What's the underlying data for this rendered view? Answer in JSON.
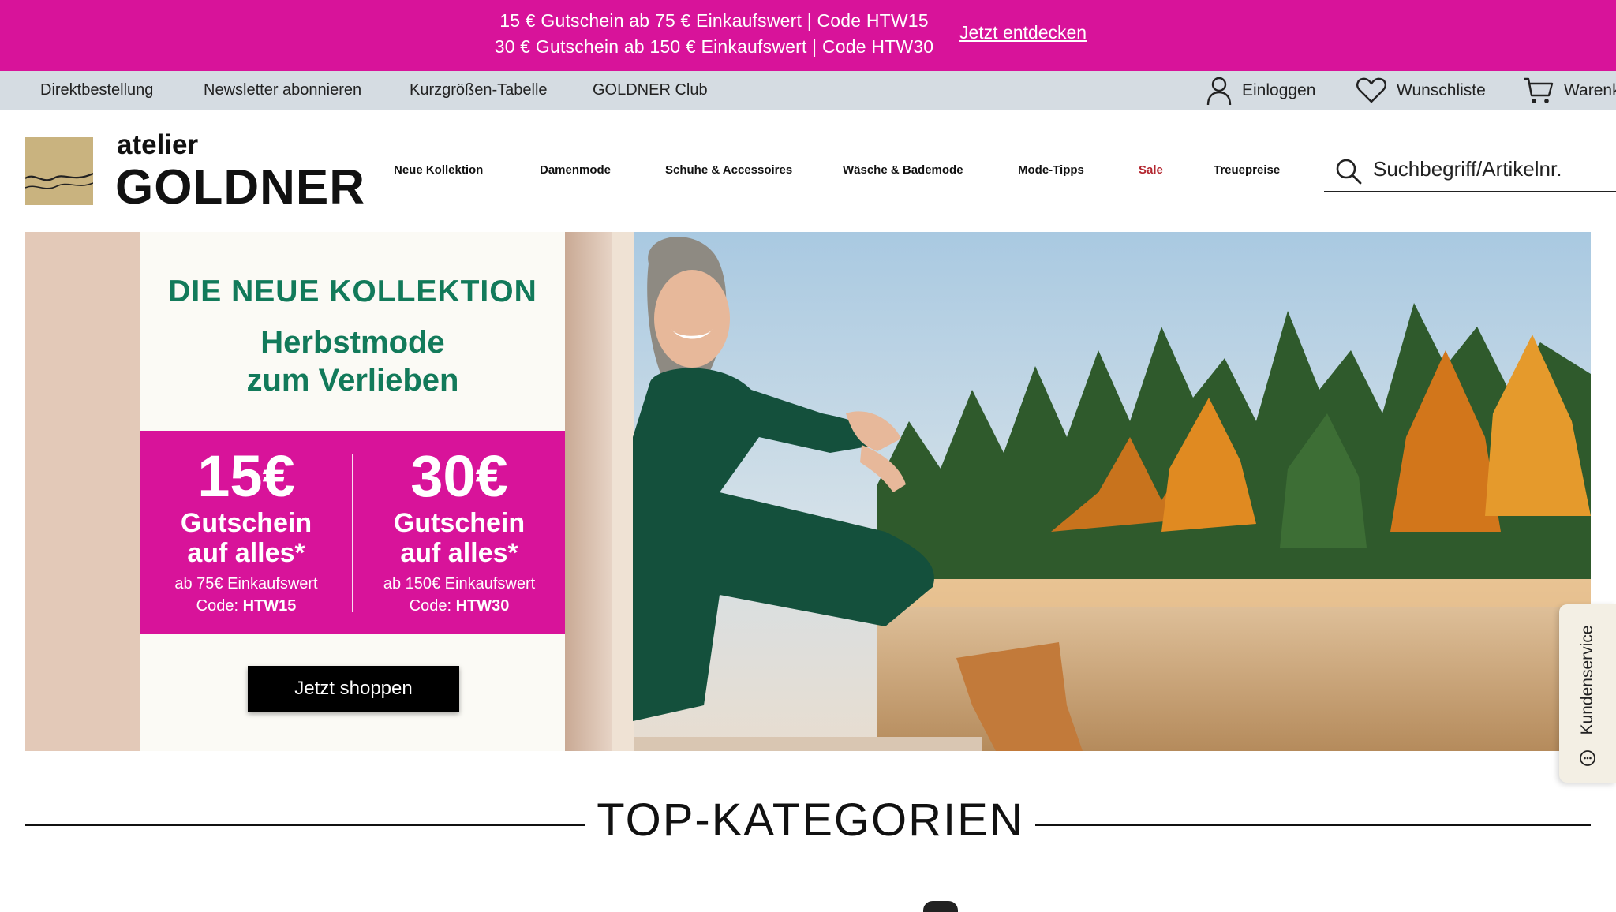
{
  "promo": {
    "line1": "15 € Gutschein ab 75 € Einkaufswert | Code HTW15",
    "line2": "30 € Gutschein ab 150 € Einkaufswert | Code HTW30",
    "link": "Jetzt entdecken",
    "color": "#d8139a"
  },
  "servicebar": {
    "links": [
      "Direktbestellung",
      "Newsletter abonnieren",
      "Kurzgrößen-Tabelle",
      "GOLDNER Club"
    ],
    "login": "Einloggen",
    "wishlist": "Wunschliste",
    "cart": "Warenk"
  },
  "header": {
    "logo_top": "atelier",
    "logo_main": "GOLDNER",
    "nav": [
      "Neue Kollektion",
      "Damenmode",
      "Schuhe & Accessoires",
      "Wäsche & Bademode",
      "Mode-Tipps",
      "Sale",
      "Treuepreise"
    ],
    "search_placeholder": "Suchbegriff/Artikelnr.",
    "sale_color": "#b3262f"
  },
  "hero": {
    "kicker": "DIE NEUE KOLLEKTION",
    "headline_1": "Herbstmode",
    "headline_2": "zum Verlieben",
    "vouchers": [
      {
        "amount": "15€",
        "label_1": "Gutschein",
        "label_2": "auf alles*",
        "min": "ab 75€ Einkaufswert",
        "code_prefix": "Code: ",
        "code": "HTW15"
      },
      {
        "amount": "30€",
        "label_1": "Gutschein",
        "label_2": "auf alles*",
        "min": "ab 150€ Einkaufswert",
        "code_prefix": "Code: ",
        "code": "HTW30"
      }
    ],
    "cta": "Jetzt shoppen",
    "accent_color": "#127a5a"
  },
  "service_tab": {
    "label": "Kundenservice"
  },
  "sections": {
    "top_categories": "TOP-KATEGORIEN"
  }
}
